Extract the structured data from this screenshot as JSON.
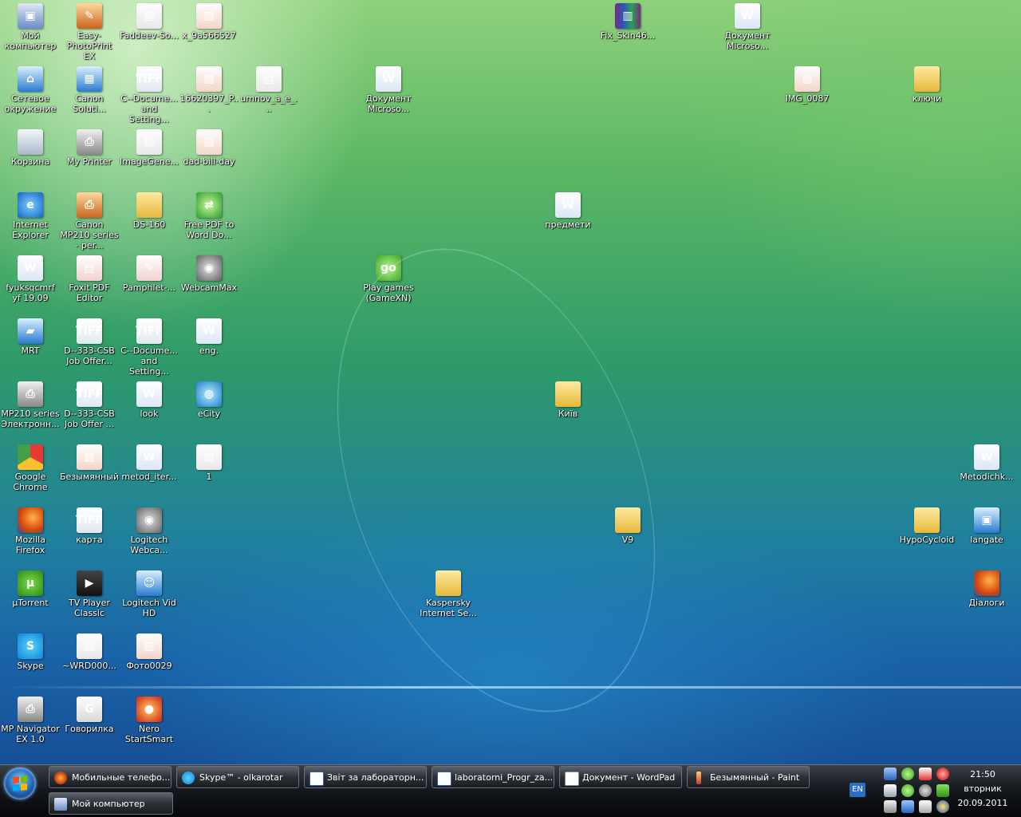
{
  "desktop": {
    "icons": [
      {
        "label": "Мой компьютер"
      },
      {
        "label": "Easy-PhotoPrint EX"
      },
      {
        "label": "Faddeev-So..."
      },
      {
        "label": "x_9a566527"
      },
      {
        "label": "Сетевое окружение"
      },
      {
        "label": "Canon Soluti..."
      },
      {
        "label": "C--Docume... and Setting..."
      },
      {
        "label": "16620397_P..."
      },
      {
        "label": "umnov_a_e_..."
      },
      {
        "label": "Корзина"
      },
      {
        "label": "My Printer"
      },
      {
        "label": "ImageGene..."
      },
      {
        "label": "dad-bill-day"
      },
      {
        "label": "Internet Explorer"
      },
      {
        "label": "Canon MP210 series - per..."
      },
      {
        "label": "DS-160"
      },
      {
        "label": "Free PDF to Word Do..."
      },
      {
        "label": "fyuksqcmrf yf 19.09"
      },
      {
        "label": "Foxit PDF Editor"
      },
      {
        "label": "Pamphlet-..."
      },
      {
        "label": "WebcamMax"
      },
      {
        "label": "MRT"
      },
      {
        "label": "D--333-CSB Job Offer..."
      },
      {
        "label": "C--Docume... and Setting..."
      },
      {
        "label": "eng."
      },
      {
        "label": "MP210 series Электронн..."
      },
      {
        "label": "D--333-CSB Job Offer ..."
      },
      {
        "label": "look"
      },
      {
        "label": "eCity"
      },
      {
        "label": "Google Chrome"
      },
      {
        "label": "Безымянный"
      },
      {
        "label": "metod_iter..."
      },
      {
        "label": "1"
      },
      {
        "label": "Mozilla Firefox"
      },
      {
        "label": "карта"
      },
      {
        "label": "Logitech Webca..."
      },
      {
        "label": "µTorrent"
      },
      {
        "label": "TV Player Classic"
      },
      {
        "label": "Logitech Vid HD"
      },
      {
        "label": "Skype"
      },
      {
        "label": "~WRD000..."
      },
      {
        "label": "Фото0029"
      },
      {
        "label": "MP Navigator EX 1.0"
      },
      {
        "label": "Говорилка"
      },
      {
        "label": "Nero StartSmart"
      },
      {
        "label": "Документ Microso..."
      },
      {
        "label": "Play games (GameXN)"
      },
      {
        "label": "Kaspersky Internet Se..."
      },
      {
        "label": "предмети"
      },
      {
        "label": "Київ"
      },
      {
        "label": "Fix_Skin46..."
      },
      {
        "label": "V9"
      },
      {
        "label": "Документ Microso..."
      },
      {
        "label": "IMG_0087"
      },
      {
        "label": "ключи"
      },
      {
        "label": "HypoCycloid"
      },
      {
        "label": "Metodichk..."
      },
      {
        "label": "langate"
      },
      {
        "label": "Діалоги"
      }
    ]
  },
  "taskbar": {
    "tasks_row1": [
      {
        "label": "Мобильные телефо..."
      },
      {
        "label": "Skype™ - olkarotar"
      },
      {
        "label": "Звіт за лабораторн..."
      },
      {
        "label": "laboratorni_Progr_za..."
      },
      {
        "label": "Документ - WordPad"
      },
      {
        "label": "Безымянный - Paint"
      }
    ],
    "tasks_row2": [
      {
        "label": "Мой компьютер"
      }
    ],
    "language": "EN",
    "clock": {
      "time": "21:50",
      "day": "вторник",
      "date": "20.09.2011"
    }
  }
}
